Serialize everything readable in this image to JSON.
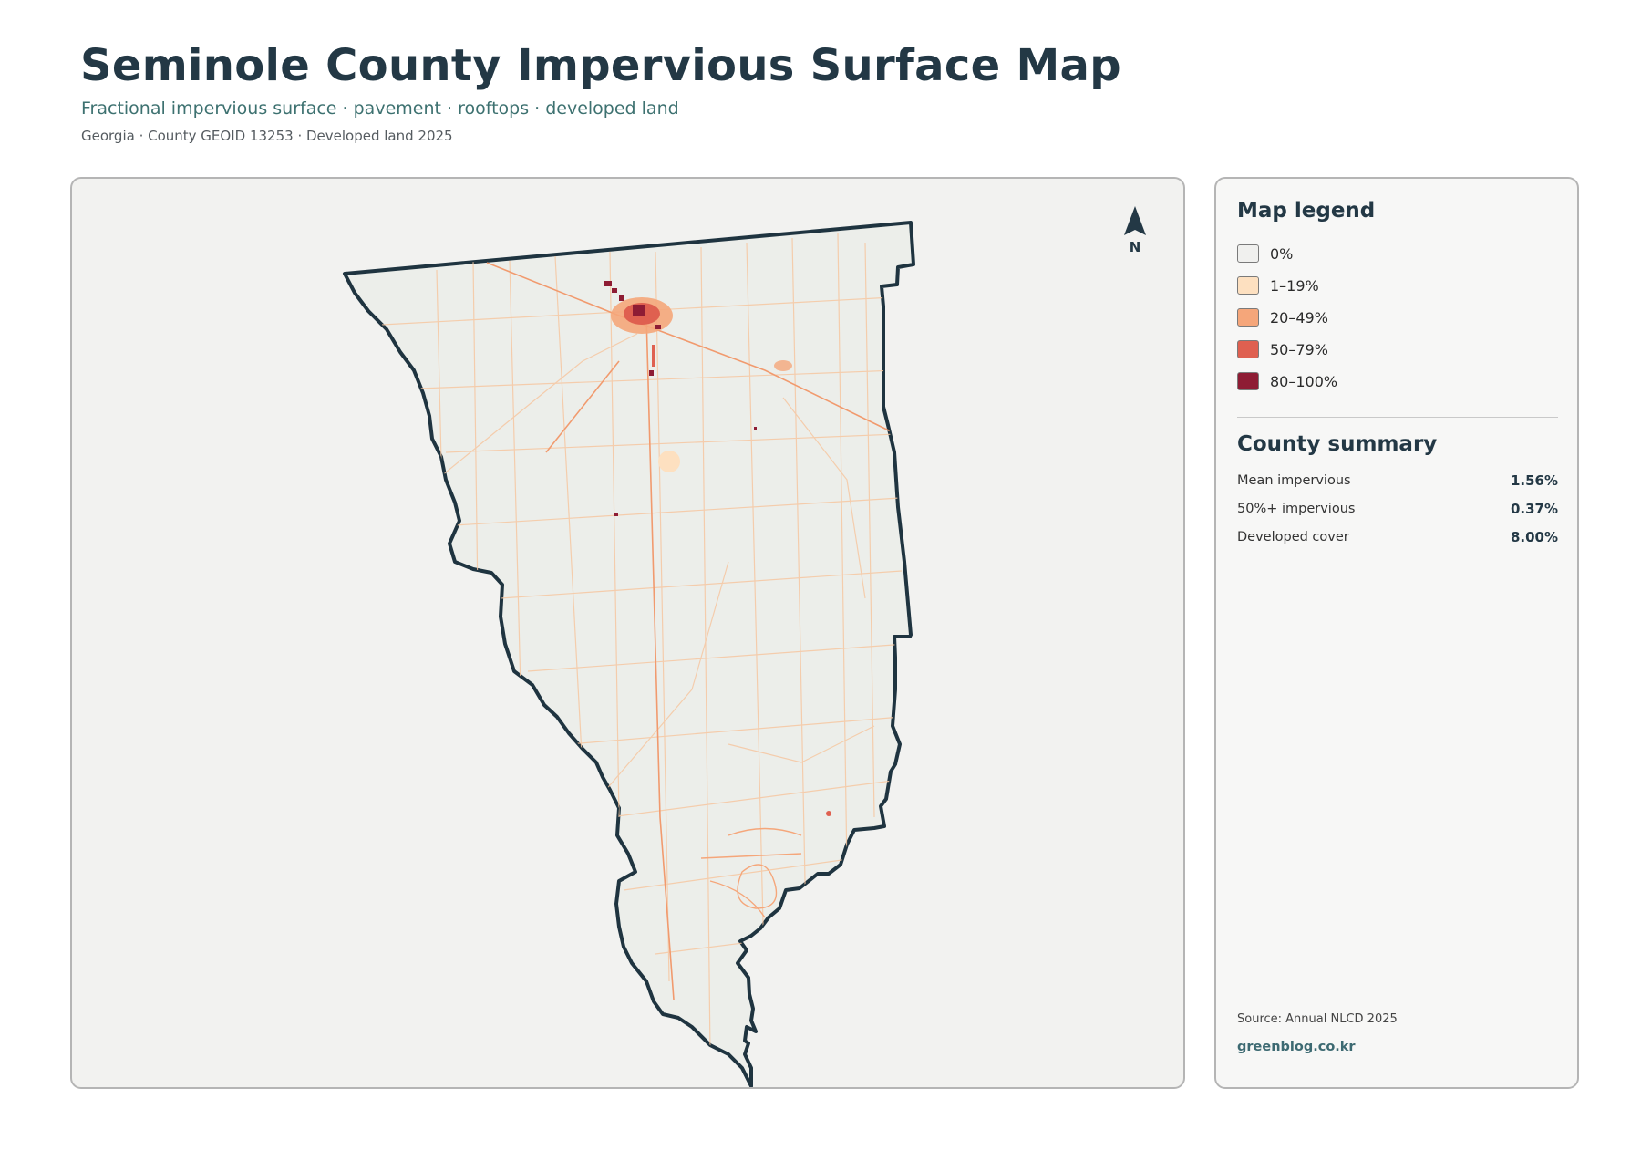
{
  "header": {
    "title": "Seminole County Impervious Surface Map",
    "subtitle": "Fractional impervious surface · pavement · rooftops · developed land",
    "meta": "Georgia · County GEOID 13253 · Developed land 2025"
  },
  "map": {
    "north_arrow": {
      "label": "N",
      "icon": "north-arrow-icon"
    },
    "boundary_color": "#1f3440",
    "fill_color": "#eceeea"
  },
  "legend": {
    "title": "Map legend",
    "items": [
      {
        "label": "0%",
        "color": "#f0f0ee"
      },
      {
        "label": "1–19%",
        "color": "#fde0c0"
      },
      {
        "label": "20–49%",
        "color": "#f5a67a"
      },
      {
        "label": "50–79%",
        "color": "#df6050"
      },
      {
        "label": "80–100%",
        "color": "#8e1c34"
      }
    ]
  },
  "summary": {
    "title": "County summary",
    "stats": [
      {
        "label": "Mean impervious",
        "value": "1.56%"
      },
      {
        "label": "50%+ impervious",
        "value": "0.37%"
      },
      {
        "label": "Developed cover",
        "value": "8.00%"
      }
    ]
  },
  "footer": {
    "source": "Source: Annual NLCD 2025",
    "site": "greenblog.co.kr"
  }
}
